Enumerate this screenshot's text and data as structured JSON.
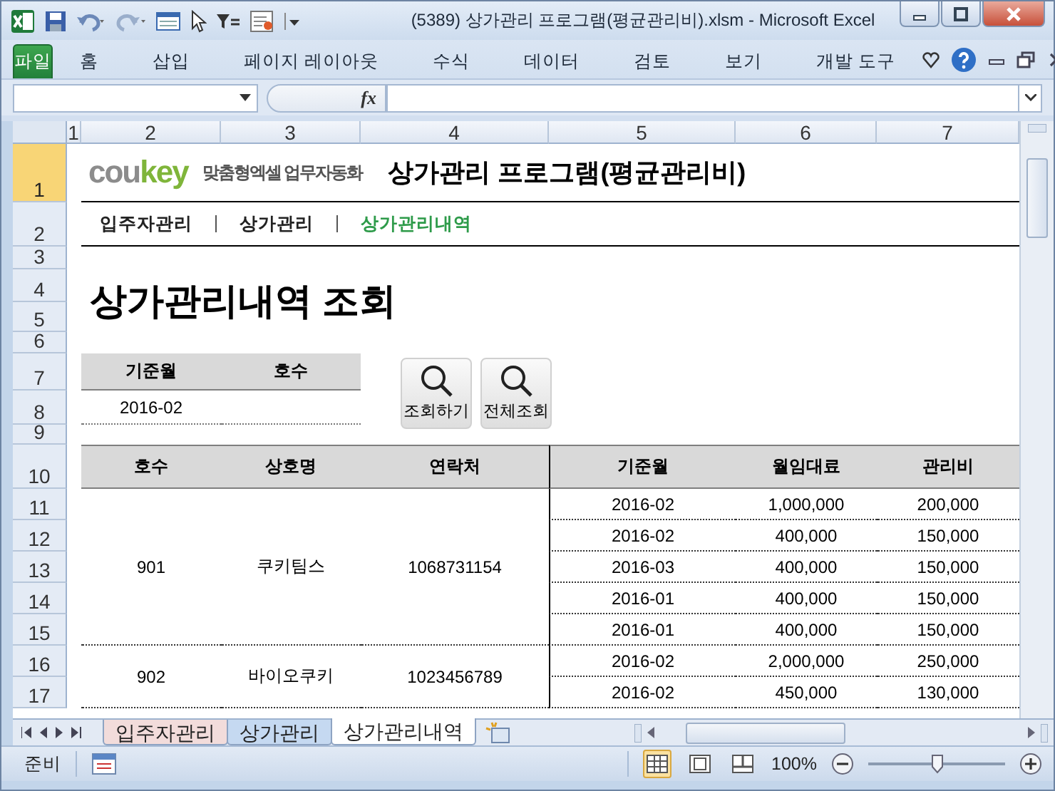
{
  "window": {
    "title": "(5389) 상가관리 프로그램(평균관리비).xlsm  -  Microsoft Excel"
  },
  "ribbon": {
    "file_button": "파일",
    "tabs": [
      {
        "label": "홈",
        "selected": false
      },
      {
        "label": "삽입",
        "selected": false
      },
      {
        "label": "페이지 레이아웃",
        "selected": false
      },
      {
        "label": "수식",
        "selected": false
      },
      {
        "label": "데이터",
        "selected": false
      },
      {
        "label": "검토",
        "selected": false
      },
      {
        "label": "보기",
        "selected": false
      },
      {
        "label": "개발 도구",
        "selected": false
      }
    ]
  },
  "formula_bar": {
    "fx": "fx"
  },
  "columns": [
    "1",
    "2",
    "3",
    "4",
    "5",
    "6",
    "7"
  ],
  "rows": [
    {
      "label": "1",
      "selected": true
    },
    {
      "label": "2",
      "selected": false
    },
    {
      "label": "3",
      "selected": false
    },
    {
      "label": "4",
      "selected": false
    },
    {
      "label": "5",
      "selected": false
    },
    {
      "label": "6",
      "selected": false
    },
    {
      "label": "7",
      "selected": false
    },
    {
      "label": "8",
      "selected": false
    },
    {
      "label": "9",
      "selected": false
    },
    {
      "label": "10",
      "selected": false
    },
    {
      "label": "11",
      "selected": false
    },
    {
      "label": "12",
      "selected": false
    },
    {
      "label": "13",
      "selected": false
    },
    {
      "label": "14",
      "selected": false
    },
    {
      "label": "15",
      "selected": false
    },
    {
      "label": "16",
      "selected": false
    },
    {
      "label": "17",
      "selected": false
    }
  ],
  "sheet": {
    "logo": {
      "brand_gray": "cou",
      "brand_green": "key",
      "tagline": "맞춤형엑셀 업무자동화"
    },
    "title": "상가관리 프로그램(평균관리비)",
    "nav": [
      {
        "label": "입주자관리",
        "selected": false
      },
      {
        "label": "상가관리",
        "selected": false
      },
      {
        "label": "상가관리내역",
        "selected": true
      }
    ],
    "heading": "상가관리내역 조회",
    "filter": {
      "columns": [
        "기준월",
        "호수"
      ],
      "month": "2016-02"
    },
    "buttons": [
      {
        "label": "조회하기"
      },
      {
        "label": "전체조회"
      }
    ],
    "table": {
      "columns": [
        "호수",
        "상호명",
        "연락처",
        "기준월",
        "월임대료",
        "관리비"
      ],
      "groups": [
        {
          "unit": "901",
          "name": "쿠키팀스",
          "phone": "1068731154",
          "rows": [
            [
              "2016-02",
              "1,000,000",
              "200,000"
            ],
            [
              "2016-02",
              "400,000",
              "150,000"
            ],
            [
              "2016-03",
              "400,000",
              "150,000"
            ],
            [
              "2016-01",
              "400,000",
              "150,000"
            ],
            [
              "2016-01",
              "400,000",
              "150,000"
            ]
          ]
        },
        {
          "unit": "902",
          "name": "바이오쿠키",
          "phone": "1023456789",
          "rows": [
            [
              "2016-02",
              "2,000,000",
              "250,000"
            ],
            [
              "2016-02",
              "450,000",
              "130,000"
            ]
          ]
        }
      ]
    }
  },
  "sheet_tabs": [
    {
      "label": "입주자관리",
      "selected": false,
      "color": "#f2dcdb"
    },
    {
      "label": "상가관리",
      "selected": false,
      "color": "#c5d9f1"
    },
    {
      "label": "상가관리내역",
      "selected": true,
      "color": "#ffffff"
    }
  ],
  "status_bar": {
    "status": "준비",
    "views": [
      {
        "kind": "normal",
        "selected": true
      },
      {
        "kind": "layout",
        "selected": false
      },
      {
        "kind": "pagebreak",
        "selected": false
      }
    ],
    "zoom": "100%",
    "zoom_slider": {
      "level": 0.5
    }
  }
}
